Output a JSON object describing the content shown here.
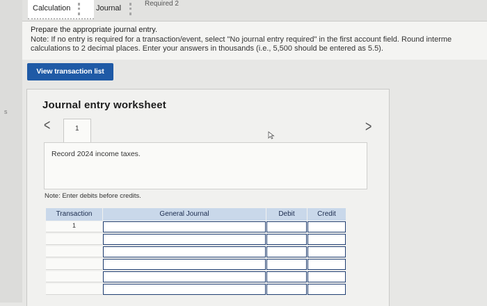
{
  "tabs": {
    "calculation": "Calculation",
    "journal": "Journal",
    "required": "Required 2"
  },
  "instructions": {
    "line1": "Prepare the appropriate journal entry.",
    "line2": "Note: If no entry is required for a transaction/event, select \"No journal entry required\" in the first account field. Round interme",
    "line3": "calculations to 2 decimal places. Enter your answers in thousands (i.e., 5,500 should be entered as 5.5)."
  },
  "view_button": "View transaction list",
  "worksheet": {
    "title": "Journal entry worksheet",
    "prev": "<",
    "next": ">",
    "step": "1",
    "description": "Record 2024 income taxes.",
    "note": "Note: Enter debits before credits."
  },
  "journal": {
    "headers": [
      "Transaction",
      "General Journal",
      "Debit",
      "Credit"
    ],
    "rows": [
      {
        "transaction": "1",
        "account": "",
        "debit": "",
        "credit": ""
      },
      {
        "transaction": "",
        "account": "",
        "debit": "",
        "credit": ""
      },
      {
        "transaction": "",
        "account": "",
        "debit": "",
        "credit": ""
      },
      {
        "transaction": "",
        "account": "",
        "debit": "",
        "credit": ""
      },
      {
        "transaction": "",
        "account": "",
        "debit": "",
        "credit": ""
      },
      {
        "transaction": "",
        "account": "",
        "debit": "",
        "credit": ""
      }
    ]
  },
  "left_mark": "s",
  "colors": {
    "button": "#1f5aa6",
    "table_header": "#c9d8ea",
    "input_border": "#1f3e72"
  }
}
